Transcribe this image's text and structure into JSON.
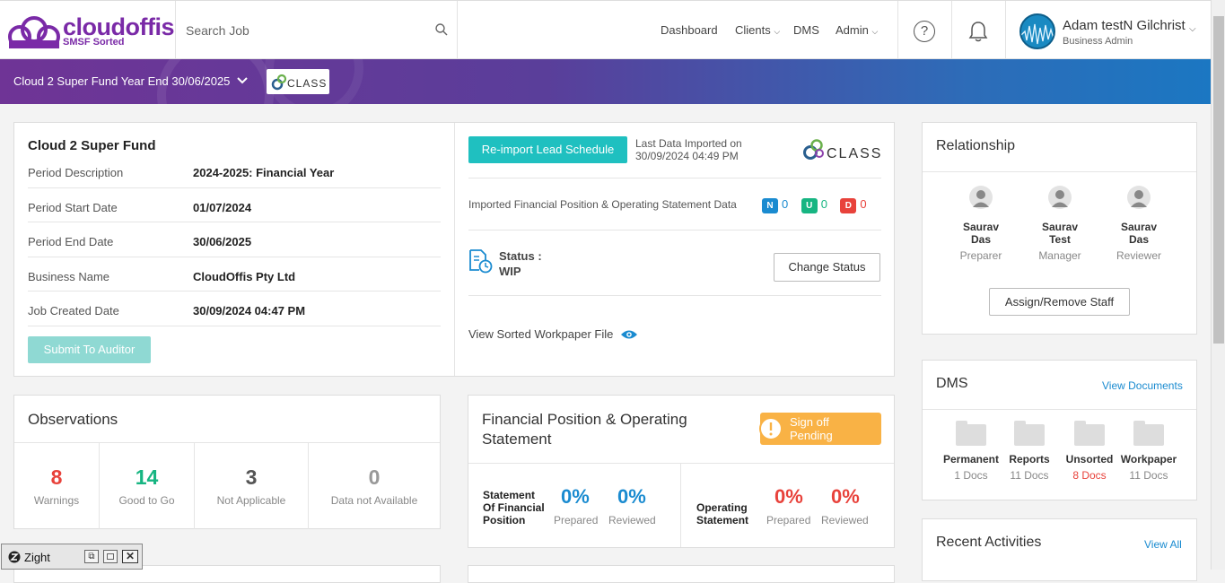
{
  "brand": {
    "name": "cloudoffis",
    "tagline": "SMSF Sorted"
  },
  "search": {
    "placeholder": "Search Job"
  },
  "nav": {
    "dashboard": "Dashboard",
    "clients": "Clients",
    "dms": "DMS",
    "admin": "Admin"
  },
  "user": {
    "name": "Adam testN Gilchrist",
    "role": "Business Admin"
  },
  "banner": {
    "job_title": "Cloud 2 Super Fund Year End 30/06/2025",
    "class_logo": "CLASS"
  },
  "fund": {
    "name": "Cloud 2 Super Fund",
    "fields": [
      {
        "label": "Period Description",
        "value": "2024-2025: Financial Year"
      },
      {
        "label": "Period Start Date",
        "value": "01/07/2024"
      },
      {
        "label": "Period End Date",
        "value": "30/06/2025"
      },
      {
        "label": "Business Name",
        "value": "CloudOffis Pty Ltd"
      },
      {
        "label": "Job Created Date",
        "value": "30/09/2024 04:47 PM"
      }
    ],
    "submit_label": "Submit To Auditor"
  },
  "import": {
    "reimport_label": "Re-import Lead Schedule",
    "last_import_label": "Last Data Imported on",
    "last_import_time": "30/09/2024 04:49 PM",
    "class_logo": "CLASS",
    "imported_label": "Imported Financial Position & Operating Statement Data",
    "badges": [
      {
        "letter": "N",
        "count": "0",
        "color": "#1a8bd0"
      },
      {
        "letter": "U",
        "count": "0",
        "color": "#17b582"
      },
      {
        "letter": "D",
        "count": "0",
        "color": "#e8423b"
      }
    ],
    "status_label": "Status :",
    "status_value": "WIP",
    "change_status_label": "Change Status",
    "view_workpaper_label": "View Sorted Workpaper File"
  },
  "relationship": {
    "title": "Relationship",
    "people": [
      {
        "first": "Saurav",
        "last": "Das",
        "role": "Preparer"
      },
      {
        "first": "Saurav",
        "last": "Test",
        "role": "Manager"
      },
      {
        "first": "Saurav",
        "last": "Das",
        "role": "Reviewer"
      }
    ],
    "assign_label": "Assign/Remove Staff"
  },
  "observations": {
    "title": "Observations",
    "items": [
      {
        "value": "8",
        "label": "Warnings",
        "color": "#e8423b"
      },
      {
        "value": "14",
        "label": "Good to Go",
        "color": "#17b582"
      },
      {
        "value": "3",
        "label": "Not Applicable",
        "color": "#555555"
      },
      {
        "value": "0",
        "label": "Data not Available",
        "color": "#999999"
      }
    ]
  },
  "financial": {
    "title_line1": "Financial Position & Operating",
    "title_line2": "Statement",
    "signoff_line1": "Sign off",
    "signoff_line2": "Pending",
    "sofp_line1": "Statement",
    "sofp_line2": "Of Financial",
    "sofp_line3": "Position",
    "sofp_prepared": "0%",
    "sofp_reviewed": "0%",
    "os_line1": "Operating",
    "os_line2": "Statement",
    "os_prepared": "0%",
    "os_reviewed": "0%",
    "prepared_label": "Prepared",
    "reviewed_label": "Reviewed"
  },
  "dms": {
    "title": "DMS",
    "view_label": "View Documents",
    "folders": [
      {
        "name": "Permanent",
        "count": "1 Docs",
        "highlight": false
      },
      {
        "name": "Reports",
        "count": "11 Docs",
        "highlight": false
      },
      {
        "name": "Unsorted",
        "count": "8 Docs",
        "highlight": true
      },
      {
        "name": "Workpaper",
        "count": "11 Docs",
        "highlight": false
      }
    ]
  },
  "activities": {
    "title": "Recent Activities",
    "view_all": "View All"
  },
  "zight": {
    "title": "Zight"
  }
}
